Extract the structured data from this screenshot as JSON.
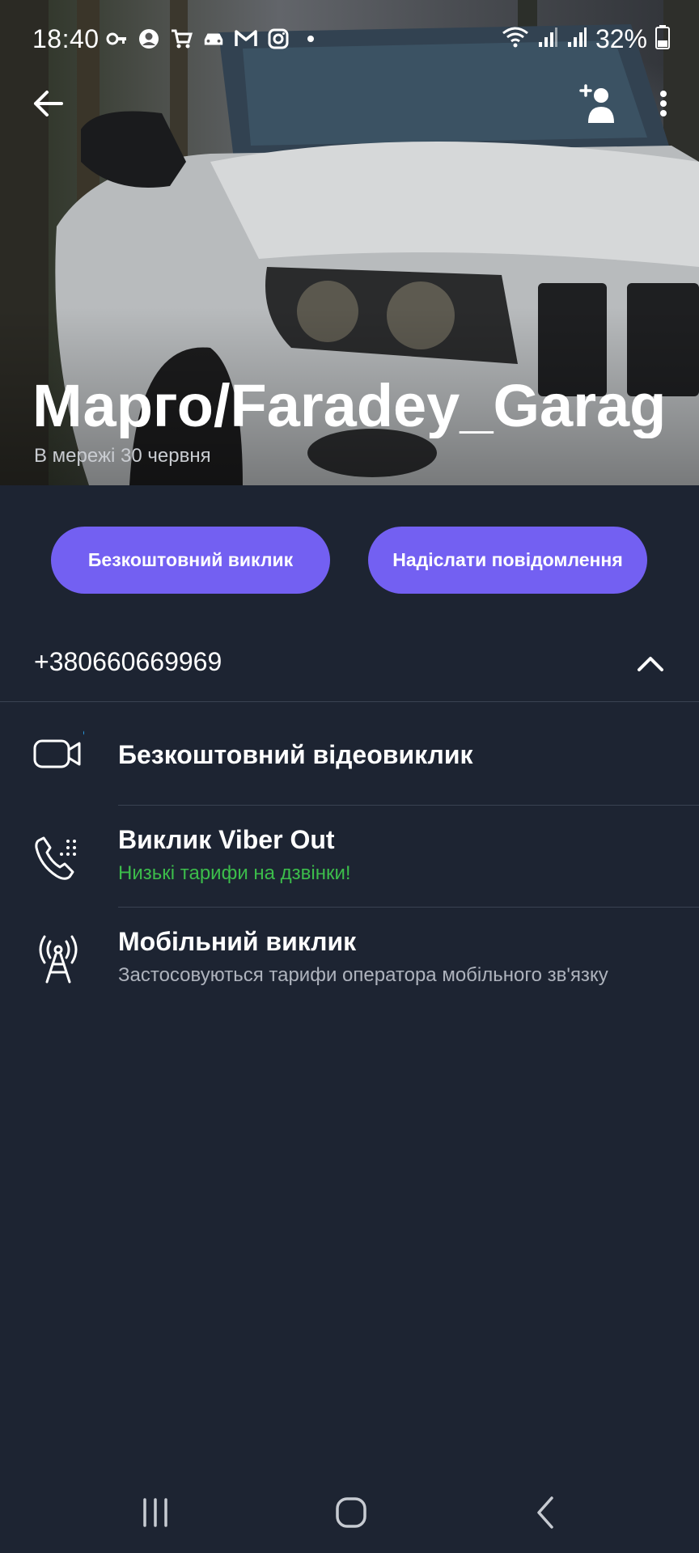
{
  "status_bar": {
    "time": "18:40",
    "battery": "32%",
    "left_icons": [
      "key-icon",
      "account-icon",
      "cart-icon",
      "car-icon",
      "gmail-icon",
      "instagram-icon",
      "dot-icon"
    ],
    "right_icons": [
      "wifi-icon",
      "signal-icon",
      "signal-icon",
      "battery-icon"
    ]
  },
  "toolbar": {
    "back_icon": "arrow-left-icon",
    "add_contact_icon": "add-contact-icon",
    "more_icon": "more-vert-icon"
  },
  "contact": {
    "name": "Марго/Faradey_Garage",
    "status": "В мережі 30 червня",
    "phone": "+380660669969"
  },
  "actions": {
    "free_call": "Безкоштовний виклик",
    "send_message": "Надіслати повідомлення"
  },
  "options": [
    {
      "title": "Безкоштовний відеовиклик",
      "subtitle": "",
      "icon": "video-icon"
    },
    {
      "title": "Виклик Viber Out",
      "subtitle": "Низькі тарифи на дзвінки!",
      "icon": "phone-dialpad-icon"
    },
    {
      "title": "Мобільний виклик",
      "subtitle": "Застосовуються тарифи оператора мобільного зв'язку",
      "icon": "cell-tower-icon"
    }
  ],
  "colors": {
    "background": "#1d2432",
    "accent": "#7360f2",
    "green": "#3cbd4b",
    "subtitle_gray": "#aeb3bd",
    "notification_dot": "#2aa3ef"
  }
}
